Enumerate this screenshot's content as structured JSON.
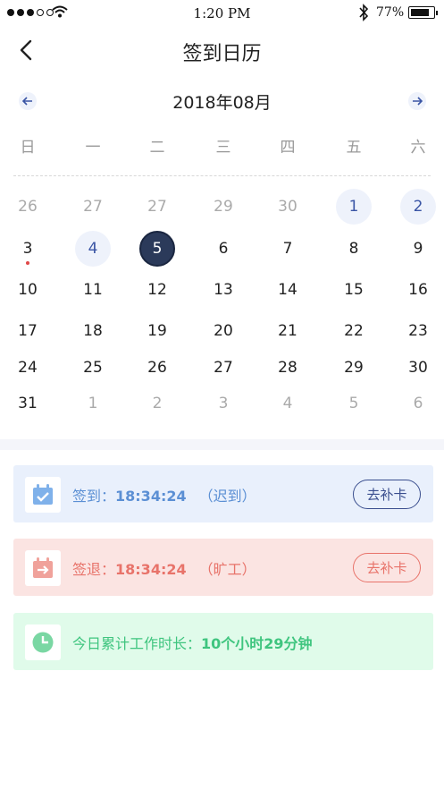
{
  "status_bar": {
    "time": "1:20 PM",
    "battery_percent": "77%",
    "battery_level": 0.77,
    "signal_bars_filled": 3,
    "signal_bars_total": 5
  },
  "nav": {
    "title": "签到日历"
  },
  "calendar": {
    "month_title": "2018年08月",
    "weekdays": [
      "日",
      "一",
      "二",
      "三",
      "四",
      "五",
      "六"
    ],
    "weeks": [
      [
        {
          "d": "26",
          "type": "other"
        },
        {
          "d": "27",
          "type": "other"
        },
        {
          "d": "27",
          "type": "other"
        },
        {
          "d": "29",
          "type": "other"
        },
        {
          "d": "30",
          "type": "other"
        },
        {
          "d": "1",
          "type": "signed"
        },
        {
          "d": "2",
          "type": "signed"
        }
      ],
      [
        {
          "d": "3",
          "type": "normal",
          "dot": true
        },
        {
          "d": "4",
          "type": "signed"
        },
        {
          "d": "5",
          "type": "selected"
        },
        {
          "d": "6",
          "type": "normal"
        },
        {
          "d": "7",
          "type": "normal"
        },
        {
          "d": "8",
          "type": "normal"
        },
        {
          "d": "9",
          "type": "normal"
        }
      ],
      [
        {
          "d": "10",
          "type": "normal"
        },
        {
          "d": "11",
          "type": "normal"
        },
        {
          "d": "12",
          "type": "normal"
        },
        {
          "d": "13",
          "type": "normal"
        },
        {
          "d": "14",
          "type": "normal"
        },
        {
          "d": "15",
          "type": "normal"
        },
        {
          "d": "16",
          "type": "normal"
        }
      ],
      [
        {
          "d": "17",
          "type": "normal"
        },
        {
          "d": "18",
          "type": "normal"
        },
        {
          "d": "19",
          "type": "normal"
        },
        {
          "d": "20",
          "type": "normal"
        },
        {
          "d": "21",
          "type": "normal"
        },
        {
          "d": "22",
          "type": "normal"
        },
        {
          "d": "23",
          "type": "normal"
        }
      ],
      [
        {
          "d": "24",
          "type": "normal"
        },
        {
          "d": "25",
          "type": "normal"
        },
        {
          "d": "26",
          "type": "normal"
        },
        {
          "d": "27",
          "type": "normal"
        },
        {
          "d": "28",
          "type": "normal"
        },
        {
          "d": "29",
          "type": "normal"
        },
        {
          "d": "30",
          "type": "normal"
        }
      ],
      [
        {
          "d": "31",
          "type": "normal"
        },
        {
          "d": "1",
          "type": "other"
        },
        {
          "d": "2",
          "type": "other"
        },
        {
          "d": "3",
          "type": "other"
        },
        {
          "d": "4",
          "type": "other"
        },
        {
          "d": "5",
          "type": "other"
        },
        {
          "d": "6",
          "type": "other"
        }
      ]
    ]
  },
  "check_in": {
    "label": "签到：",
    "time": "18:34:24",
    "note": "（迟到）",
    "action": "去补卡",
    "color": "#5b8fd4"
  },
  "check_out": {
    "label": "签退：",
    "time": "18:34:24",
    "note": "（旷工）",
    "action": "去补卡",
    "color": "#e8736a"
  },
  "work_total": {
    "label": "今日累计工作时长：",
    "value": "10个小时29分钟",
    "color": "#3fc57f"
  },
  "colors": {
    "selected_day": "#2b3a5a",
    "signed_day_bg": "#eef2fb",
    "signed_day_text": "#3a55a5",
    "absence_dot": "#e04848"
  }
}
